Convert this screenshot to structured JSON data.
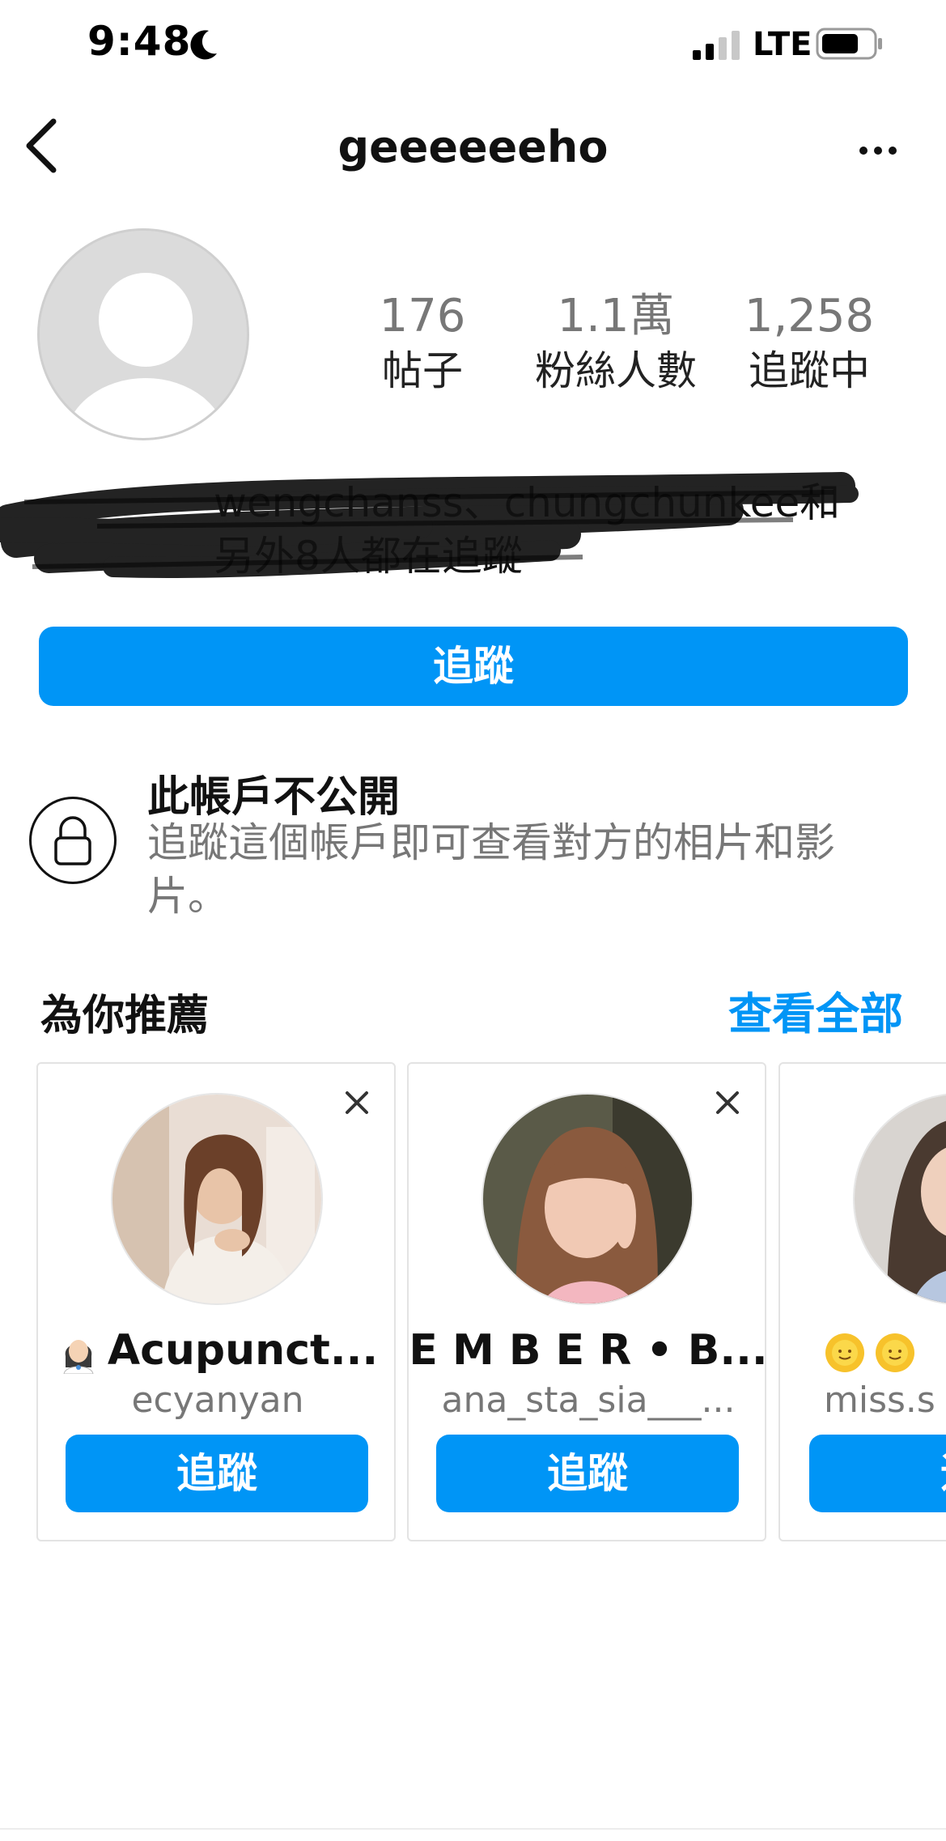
{
  "status_bar": {
    "time": "9:48",
    "network": "LTE",
    "icons": [
      "moon-icon",
      "signal-icon",
      "battery-icon"
    ]
  },
  "nav": {
    "title": "geeeeeeho",
    "icons": [
      "chevron-left-icon",
      "more-horizontal-icon"
    ]
  },
  "profile": {
    "stats": [
      {
        "value": "176",
        "label": "帖子"
      },
      {
        "value": "1.1萬",
        "label": "粉絲人數"
      },
      {
        "value": "1,258",
        "label": "追蹤中"
      }
    ],
    "followed_by_line1": "wengchanss、chungchunkee和",
    "followed_by_line2": "另外8人都在追蹤",
    "follow_label": "追蹤"
  },
  "private_notice": {
    "title": "此帳戶不公開",
    "description": "追蹤這個帳戶即可查看對方的相片和影片。"
  },
  "suggestions": {
    "title": "為你推薦",
    "see_all": "查看全部",
    "cards": [
      {
        "name": "Acupunct...",
        "username": "ecyanyan",
        "follow": "追蹤",
        "name_prefix_emoji": "woman-health-worker"
      },
      {
        "name": "E M B E R • B...",
        "username": "ana_sta_sia___...",
        "follow": "追蹤"
      },
      {
        "name": "miss.s",
        "username": "miss.s",
        "follow": "追",
        "name_prefix_emoji": "sun-with-face"
      }
    ]
  },
  "colors": {
    "accent": "#0095f6",
    "muted_text": "#777777",
    "border": "#e3e3e3",
    "avatar_placeholder": "#dbdbdb"
  }
}
